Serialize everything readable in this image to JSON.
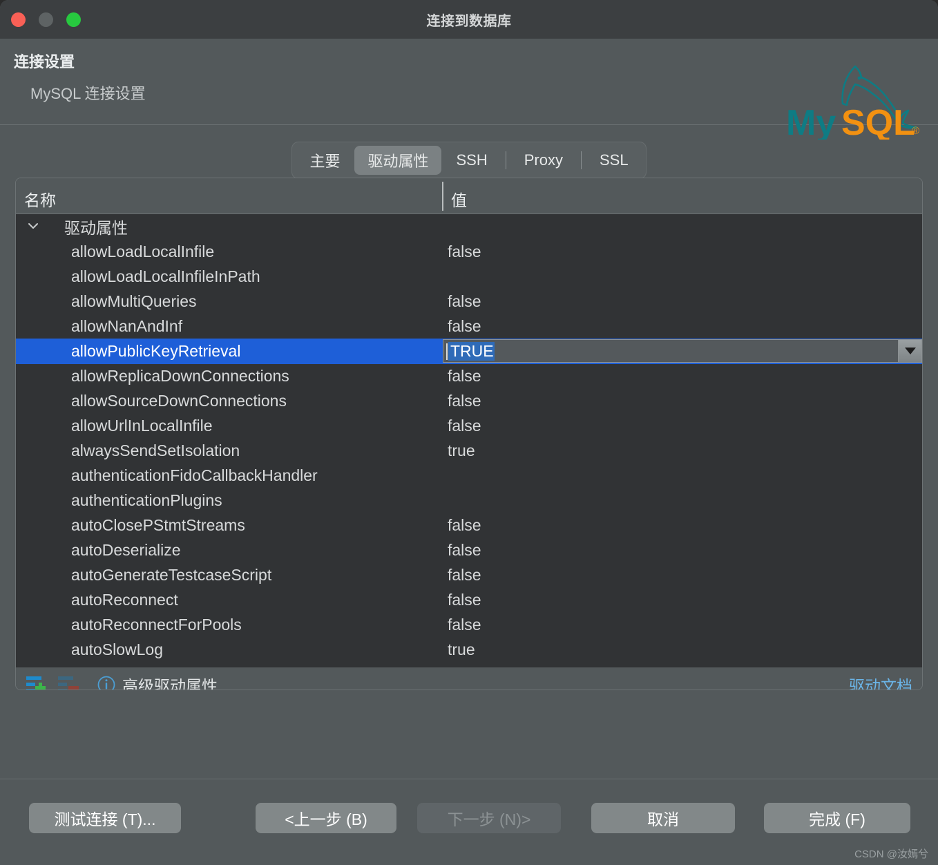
{
  "window": {
    "title": "连接到数据库",
    "traffic_lights": [
      "close-button",
      "minimize-button",
      "maximize-button"
    ]
  },
  "header": {
    "title": "连接设置",
    "subtitle": "MySQL 连接设置",
    "logo": "mysql-logo",
    "logo_colors": {
      "dolphin": "#00758f",
      "text_my": "#00758f",
      "text_sql": "#f29111"
    }
  },
  "tabs": [
    {
      "label": "主要",
      "active": false
    },
    {
      "label": "驱动属性",
      "active": true
    },
    {
      "label": "SSH",
      "active": false
    },
    {
      "label": "Proxy",
      "active": false
    },
    {
      "label": "SSL",
      "active": false
    }
  ],
  "table": {
    "columns": [
      "名称",
      "值"
    ],
    "group": {
      "label": "驱动属性",
      "expanded": true,
      "chevron": "chevron-down-icon"
    },
    "rows": [
      {
        "name": "allowLoadLocalInfile",
        "value": "false"
      },
      {
        "name": "allowLoadLocalInfileInPath",
        "value": ""
      },
      {
        "name": "allowMultiQueries",
        "value": "false"
      },
      {
        "name": "allowNanAndInf",
        "value": "false"
      },
      {
        "name": "allowPublicKeyRetrieval",
        "value": "TRUE",
        "selected": true,
        "editing": true
      },
      {
        "name": "allowReplicaDownConnections",
        "value": "false"
      },
      {
        "name": "allowSourceDownConnections",
        "value": "false"
      },
      {
        "name": "allowUrlInLocalInfile",
        "value": "false"
      },
      {
        "name": "alwaysSendSetIsolation",
        "value": "true"
      },
      {
        "name": "authenticationFidoCallbackHandler",
        "value": ""
      },
      {
        "name": "authenticationPlugins",
        "value": ""
      },
      {
        "name": "autoClosePStmtStreams",
        "value": "false"
      },
      {
        "name": "autoDeserialize",
        "value": "false"
      },
      {
        "name": "autoGenerateTestcaseScript",
        "value": "false"
      },
      {
        "name": "autoReconnect",
        "value": "false"
      },
      {
        "name": "autoReconnectForPools",
        "value": "false"
      },
      {
        "name": "autoSlowLog",
        "value": "true"
      }
    ]
  },
  "panel_footer": {
    "add_icon": "add-property-icon",
    "remove_icon": "remove-property-icon",
    "info_icon": "info-icon",
    "advanced_label": "高级驱动属性",
    "doc_link": "驱动文档"
  },
  "buttons": {
    "test": "测试连接 (T)...",
    "previous": "<上一步 (B)",
    "next": "下一步 (N)>",
    "cancel": "取消",
    "finish": "完成 (F)"
  },
  "watermark": "CSDN @汝嫣兮"
}
